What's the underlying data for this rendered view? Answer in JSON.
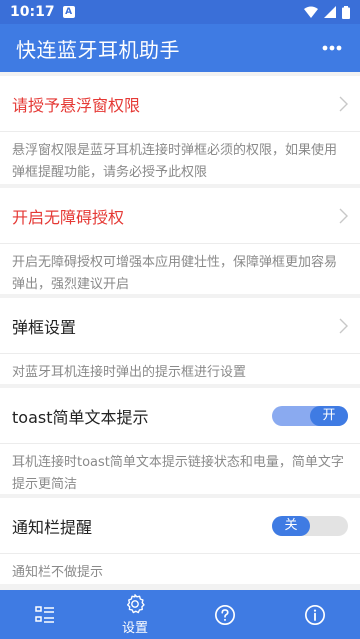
{
  "status": {
    "time": "10:17",
    "notif": "A"
  },
  "app": {
    "title": "快连蓝牙耳机助手"
  },
  "settings": [
    {
      "title": "请授予悬浮窗权限",
      "desc": "悬浮窗权限是蓝牙耳机连接时弹框必须的权限，如果使用弹框提醒功能，请务必授予此权限"
    },
    {
      "title": "开启无障碍授权",
      "desc": "开启无障碍授权可增强本应用健壮性，保障弹框更加容易弹出，强烈建议开启"
    },
    {
      "title": "弹框设置",
      "desc": "对蓝牙耳机连接时弹出的提示框进行设置"
    },
    {
      "title": "toast简单文本提示",
      "desc": "耳机连接时toast简单文本提示链接状态和电量，简单文字提示更简洁",
      "toggle": "开"
    },
    {
      "title": "通知栏提醒",
      "desc": "通知栏不做提示",
      "toggle": "关"
    }
  ],
  "nav": {
    "settings_label": "设置"
  },
  "colors": {
    "primary": "#3f7be3",
    "warning": "#e53935"
  }
}
